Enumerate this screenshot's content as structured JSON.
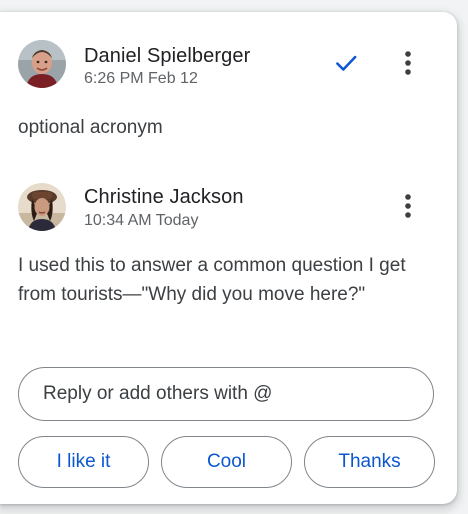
{
  "comments": [
    {
      "author": "Daniel Spielberger",
      "timestamp": "6:26 PM Feb 12",
      "body": "optional acronym",
      "resolved_icon": "checkmark-icon",
      "more_icon": "more-vert-icon"
    },
    {
      "author": "Christine Jackson",
      "timestamp": "10:34 AM Today",
      "body": "I used this to answer a common question I get from tourists—\"Why did you move here?\"",
      "more_icon": "more-vert-icon"
    }
  ],
  "reply": {
    "placeholder": "Reply or add others with @",
    "value": ""
  },
  "suggestions": [
    "I like it",
    "Cool",
    "Thanks"
  ],
  "colors": {
    "accent": "#0b57d0",
    "text_primary": "#202124",
    "text_secondary": "#5f6368",
    "border": "#80868b"
  }
}
